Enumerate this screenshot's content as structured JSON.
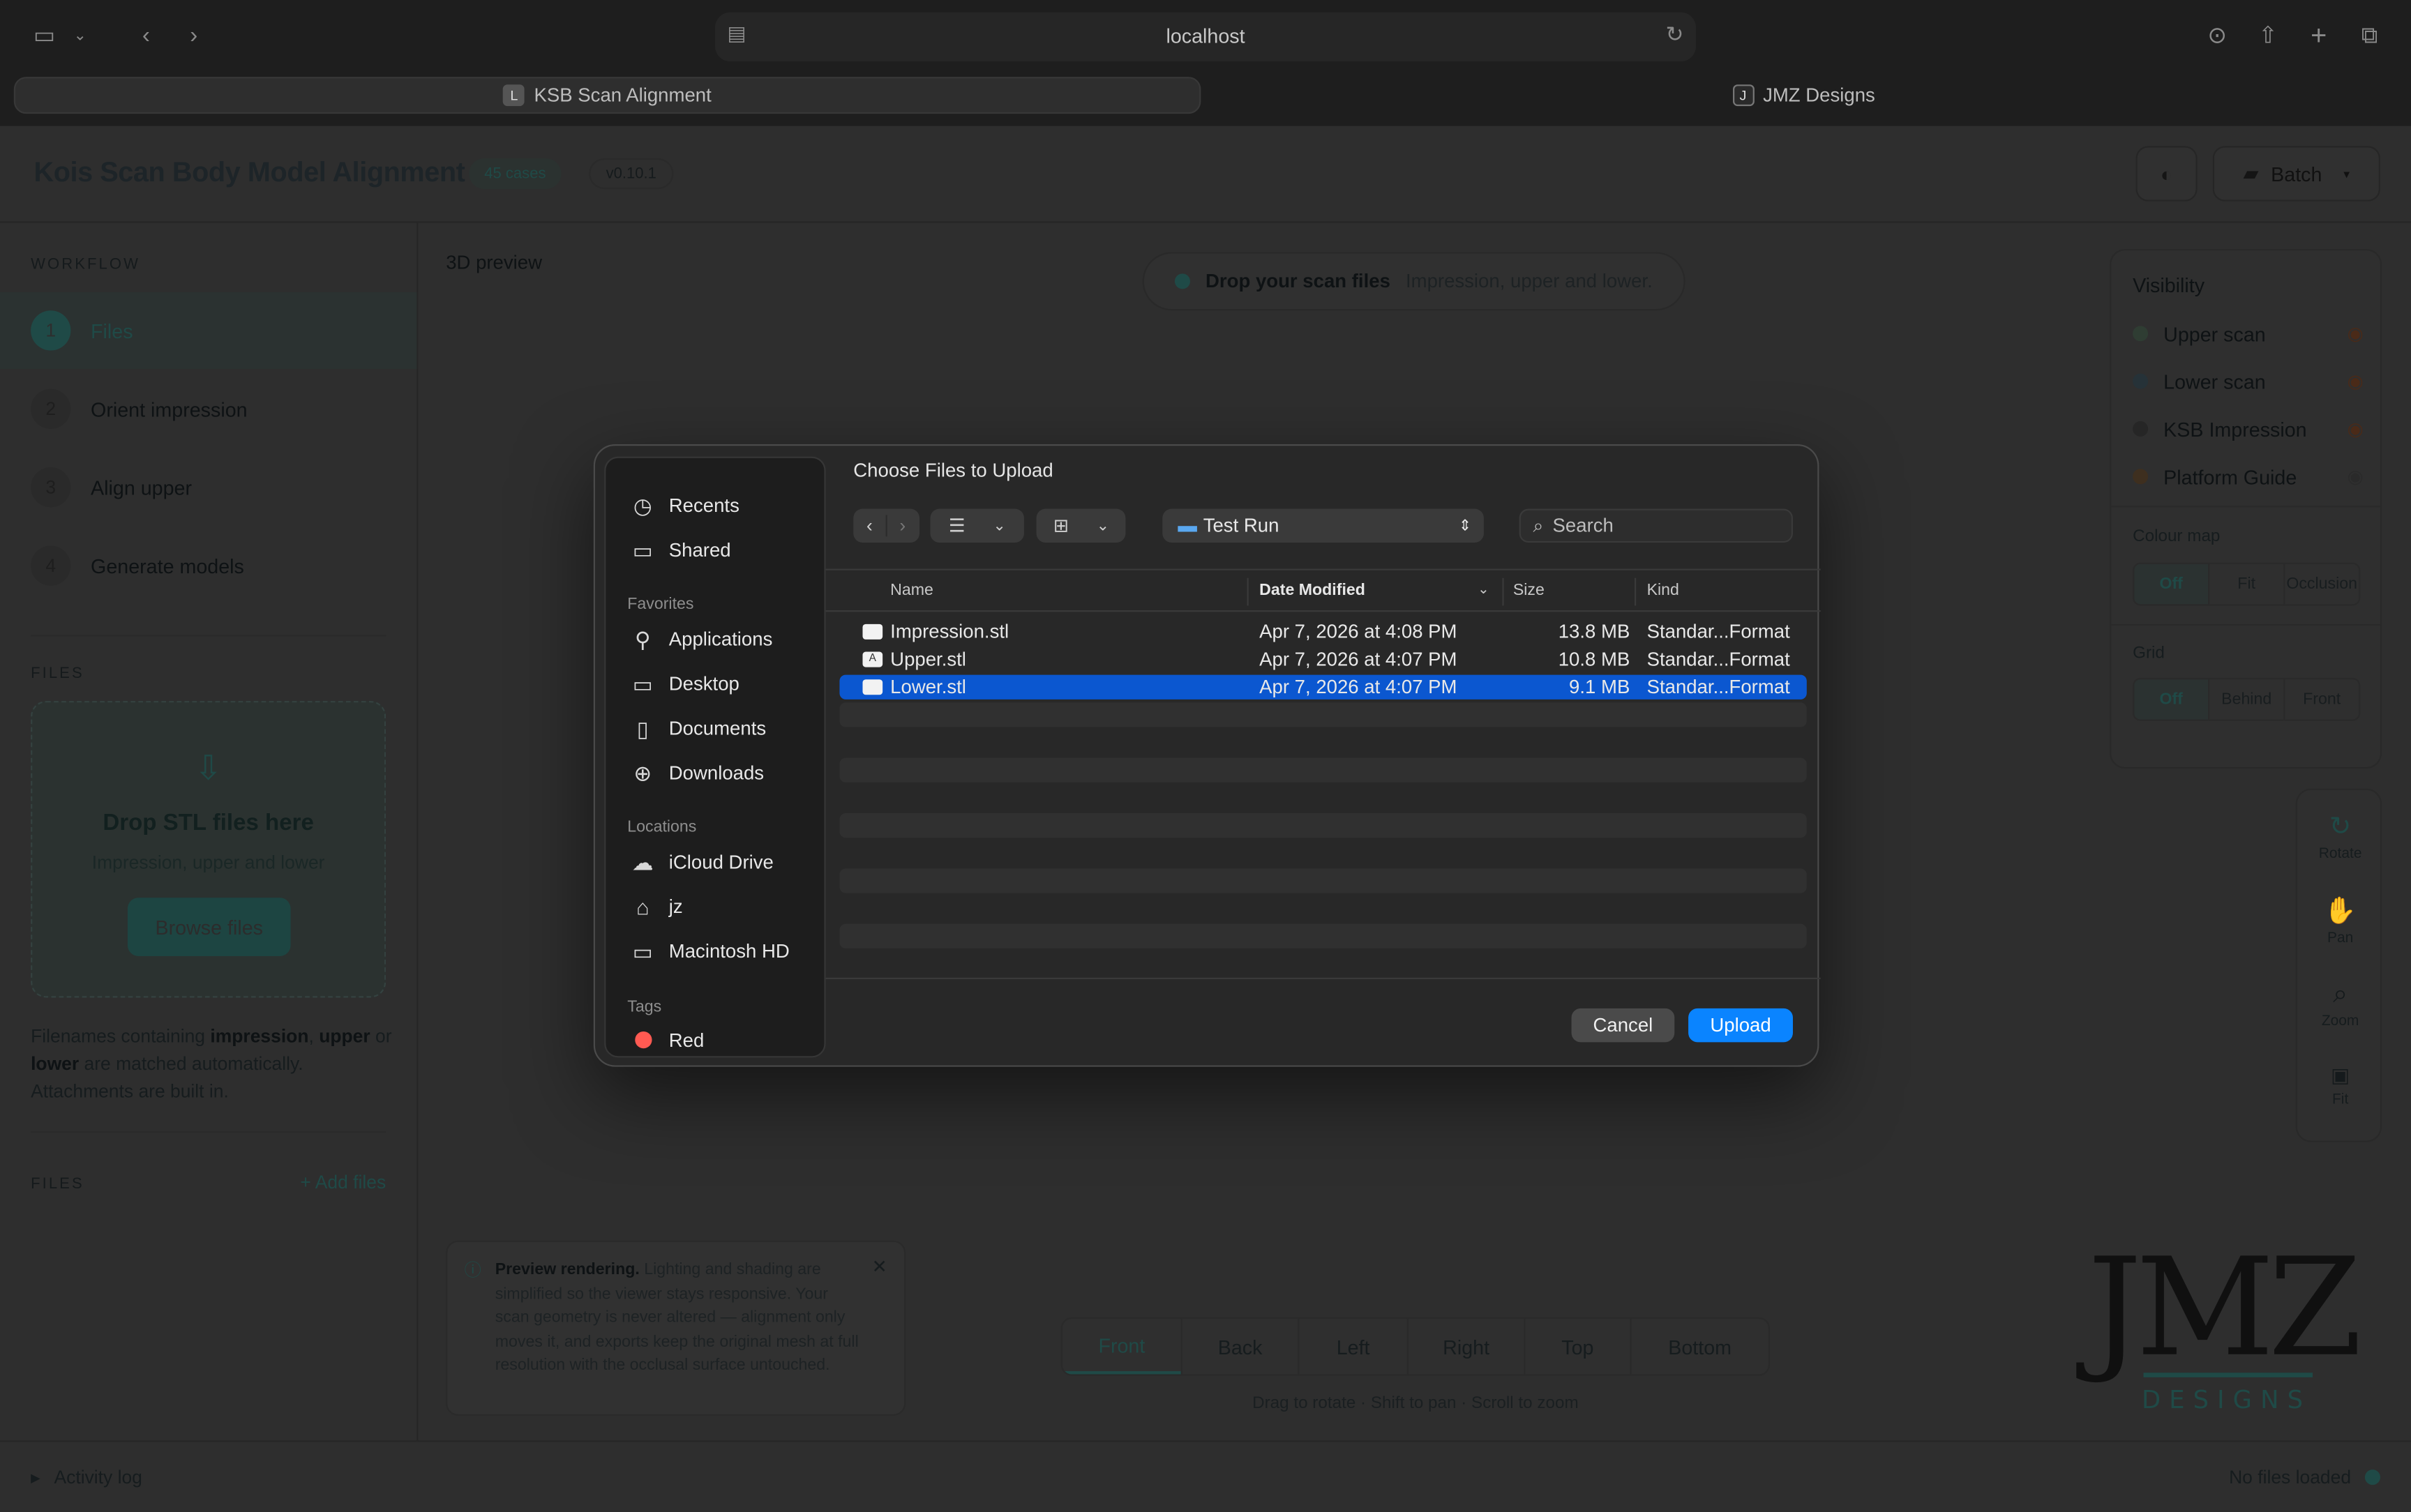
{
  "browser": {
    "address": "localhost",
    "tabs": [
      {
        "label": "KSB Scan Alignment",
        "favicon": "L",
        "active": true
      },
      {
        "label": "JMZ Designs",
        "favicon": "J",
        "active": false
      }
    ]
  },
  "app": {
    "title": "Kois Scan Body Model Alignment",
    "cases_badge": "45 cases",
    "version_badge": "v0.10.1",
    "batch_label": "Batch",
    "accent": "#1f4a47"
  },
  "sidebar": {
    "workflow_label": "WORKFLOW",
    "steps": [
      {
        "num": "1",
        "label": "Files"
      },
      {
        "num": "2",
        "label": "Orient impression"
      },
      {
        "num": "3",
        "label": "Align upper"
      },
      {
        "num": "4",
        "label": "Generate models"
      }
    ],
    "files_label": "FILES",
    "dropzone": {
      "title": "Drop STL files here",
      "subtitle": "Impression, upper and lower",
      "button": "Browse files"
    },
    "hint": {
      "prefix": "Filenames containing ",
      "k1": "impression",
      "sep1": ", ",
      "k2": "upper",
      "sep2": " or ",
      "k3": "lower",
      "suffix": " are matched automatically. Attachments are built in."
    },
    "files_list_label": "FILES",
    "add_files": "+ Add files"
  },
  "viewer": {
    "label": "3D preview",
    "drop_pill_title": "Drop your scan files",
    "drop_pill_sub": "Impression, upper and lower.",
    "visibility": {
      "title": "Visibility",
      "items": [
        {
          "label": "Upper scan",
          "color": "#2f3d33"
        },
        {
          "label": "Lower scan",
          "color": "#263238"
        },
        {
          "label": "KSB Impression",
          "color": "#262626"
        },
        {
          "label": "Platform Guide",
          "color": "#3e2f1f"
        }
      ],
      "colour_map_title": "Colour map",
      "colour_map_options": [
        "Off",
        "Fit",
        "Occlusion"
      ],
      "grid_title": "Grid",
      "grid_options": [
        "Off",
        "Behind",
        "Front"
      ]
    },
    "tools": [
      {
        "icon": "↻",
        "label": "Rotate"
      },
      {
        "icon": "✋",
        "label": "Pan"
      },
      {
        "icon": "⌕",
        "label": "Zoom"
      },
      {
        "icon": "▣",
        "label": "Fit"
      }
    ],
    "info": {
      "title": "Preview rendering.",
      "text": " Lighting and shading are simplified so the viewer stays responsive. Your scan geometry is never altered — alignment only moves it, and exports keep the original mesh at full resolution with the occlusal surface untouched."
    },
    "views": [
      "Front",
      "Back",
      "Left",
      "Right",
      "Top",
      "Bottom"
    ],
    "view_hint": "Drag to rotate · Shift to pan · Scroll to zoom",
    "logo": {
      "main": "JMZ",
      "sub": "DESIGNS"
    }
  },
  "footer": {
    "activity": "Activity log",
    "status": "No files loaded"
  },
  "dialog": {
    "title": "Choose Files to Upload",
    "sidebar": {
      "recents": "Recents",
      "shared": "Shared",
      "favorites_head": "Favorites",
      "favorites": [
        "Applications",
        "Desktop",
        "Documents",
        "Downloads"
      ],
      "locations_head": "Locations",
      "locations": [
        "iCloud Drive",
        "jz",
        "Macintosh HD"
      ],
      "tags_head": "Tags",
      "tag_red": "Red"
    },
    "path": "Test Run",
    "search_placeholder": "Search",
    "columns": {
      "name": "Name",
      "date": "Date Modified",
      "size": "Size",
      "kind": "Kind"
    },
    "files": [
      {
        "name": "Impression.stl",
        "date": "Apr 7, 2026 at 4:08 PM",
        "size": "13.8 MB",
        "kind": "Standar...Format"
      },
      {
        "name": "Upper.stl",
        "date": "Apr 7, 2026 at 4:07 PM",
        "size": "10.8 MB",
        "kind": "Standar...Format"
      },
      {
        "name": "Lower.stl",
        "date": "Apr 7, 2026 at 4:07 PM",
        "size": "9.1 MB",
        "kind": "Standar...Format"
      }
    ],
    "cancel": "Cancel",
    "upload": "Upload",
    "select_color": "#0b57d0"
  }
}
